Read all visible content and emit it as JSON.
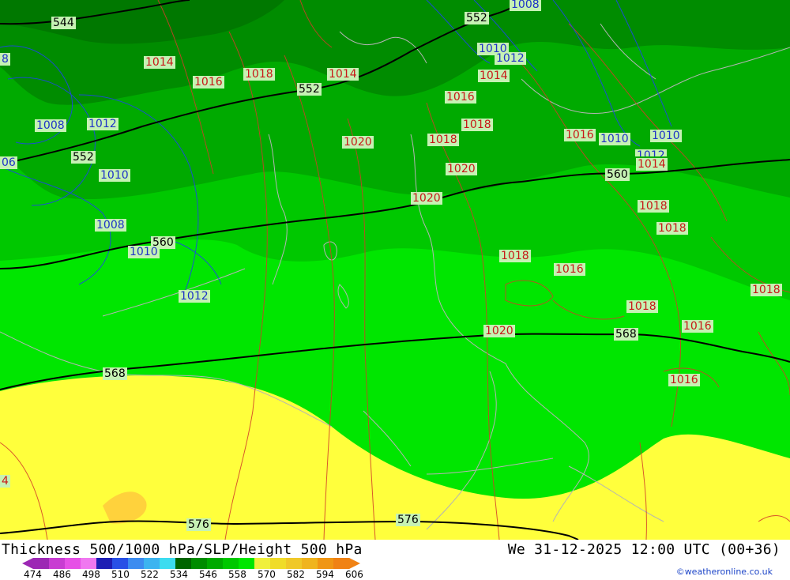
{
  "colors": {
    "sea_level_pressure": "#d23c28",
    "pressure_low": "#1e46e6",
    "height_500": "#000000",
    "borders": "#b4b4b4"
  },
  "map": {
    "height_labels": [
      {
        "id": "h544",
        "text": "544"
      },
      {
        "id": "h552a",
        "text": "552"
      },
      {
        "id": "h552b",
        "text": "552"
      },
      {
        "id": "h552c",
        "text": "552"
      },
      {
        "id": "h560a",
        "text": "560"
      },
      {
        "id": "h560b",
        "text": "560"
      },
      {
        "id": "h568a",
        "text": "568"
      },
      {
        "id": "h568b",
        "text": "568"
      },
      {
        "id": "h576a",
        "text": "576"
      },
      {
        "id": "h576b",
        "text": "576"
      }
    ],
    "pressure_labels_red": [
      "1014",
      "1016",
      "1018",
      "1014",
      "1014",
      "1016",
      "1018",
      "1020",
      "1018",
      "1020",
      "1020",
      "1016",
      "1014",
      "1018",
      "1018",
      "1018",
      "1016",
      "1018",
      "1016",
      "1020",
      "1016",
      "1018",
      "4"
    ],
    "pressure_labels_blue": [
      "1008",
      "1010",
      "1012",
      "1008",
      "1012",
      "06",
      "1010",
      "1008",
      "1010",
      "1012",
      "1010",
      "1010",
      "1012",
      "8"
    ]
  },
  "footer": {
    "title": "Thickness 500/1000 hPa/SLP/Height 500 hPa",
    "datetime": "We 31-12-2025 12:00 UTC (00+36)",
    "credit": "©weatheronline.co.uk",
    "scale_ticks": [
      "474",
      "486",
      "498",
      "510",
      "522",
      "534",
      "546",
      "558",
      "570",
      "582",
      "594",
      "606"
    ],
    "scale_colors": [
      "#9c28b4",
      "#c83cd2",
      "#e650e6",
      "#f078f0",
      "#1e1eb4",
      "#2850e6",
      "#3c8cf0",
      "#3cb4f0",
      "#3cdcf0",
      "#006400",
      "#008c00",
      "#00aa00",
      "#00c800",
      "#00e600",
      "#f0f03c",
      "#f0dc28",
      "#f0c828",
      "#f0b41e",
      "#f09614",
      "#f08214"
    ]
  }
}
